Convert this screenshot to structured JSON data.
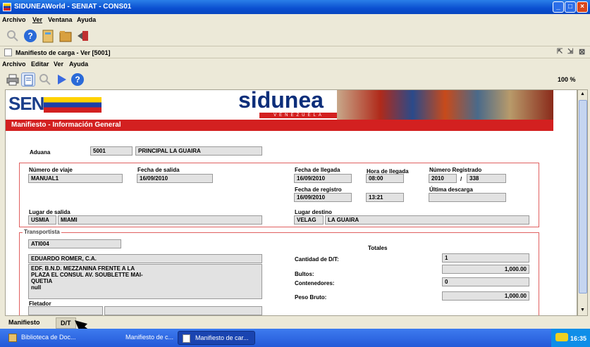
{
  "window": {
    "title": "SIDUNEAWorld - SENIAT - CONS01"
  },
  "menu": [
    "Archivo",
    "Ver",
    "Ventana",
    "Ayuda"
  ],
  "inner": {
    "title": "Manifiesto de carga - Ver [5001]",
    "menu": [
      "Archivo",
      "Editar",
      "Ver",
      "Ayuda"
    ],
    "zoom": "100 %"
  },
  "banner": {
    "seniat": "SENIAT",
    "sidunea": "sidunea",
    "venezuela": "VENEZUELA",
    "section_title": "Manifiesto - Información General"
  },
  "form": {
    "aduana_label": "Aduana",
    "aduana_code": "5001",
    "aduana_name": "PRINCIPAL LA GUAIRA",
    "num_viaje_label": "Número de viaje",
    "num_viaje": "MANUAL1",
    "fecha_salida_label": "Fecha de salida",
    "fecha_salida": "16/09/2010",
    "fecha_llegada_label": "Fecha de llegada",
    "fecha_llegada": "16/09/2010",
    "hora_llegada_label": "Hora de llegada",
    "hora_llegada": "08:00",
    "num_reg_label": "Número Registrado",
    "num_reg_year": "2010",
    "num_reg_sep": "/",
    "num_reg_num": "338",
    "fecha_registro_label": "Fecha de registro",
    "fecha_registro": "16/09/2010",
    "hora_registro": "13:21",
    "ultima_descarga_label": "Última descarga",
    "ultima_descarga": "",
    "lugar_salida_label": "Lugar de salida",
    "lugar_salida_code": "USMIA",
    "lugar_salida_name": "MIAMI",
    "lugar_destino_label": "Lugar destino",
    "lugar_destino_code": "VELAG",
    "lugar_destino_name": "LA GUAIRA",
    "transportista_label": "Transportista",
    "transportista_code": "ATI004",
    "transportista_name": "EDUARDO ROMER, C.A.",
    "transportista_addr": [
      "EDF. B.N.D. MEZZANINA FRENTE A LA",
      "PLAZA EL CONSUL AV. SOUBLETTE MAI-",
      "QUETIA",
      "null"
    ],
    "fletador_label": "Fletador",
    "totales_label": "Totales",
    "cantidad_dt_label": "Cantidad de D/T:",
    "cantidad_dt": "1",
    "bultos_label": "Bultos:",
    "bultos": "1,000.00",
    "contenedores_label": "Contenedores:",
    "contenedores": "0",
    "peso_bruto_label": "Peso Bruto:",
    "peso_bruto": "1,000.00"
  },
  "tabs": [
    "Manifiesto",
    "D/T"
  ],
  "taskbar": {
    "items": [
      "Biblioteca de Doc...",
      "Manifiesto de c...",
      "Manifiesto de car..."
    ],
    "clock": "16:35"
  }
}
